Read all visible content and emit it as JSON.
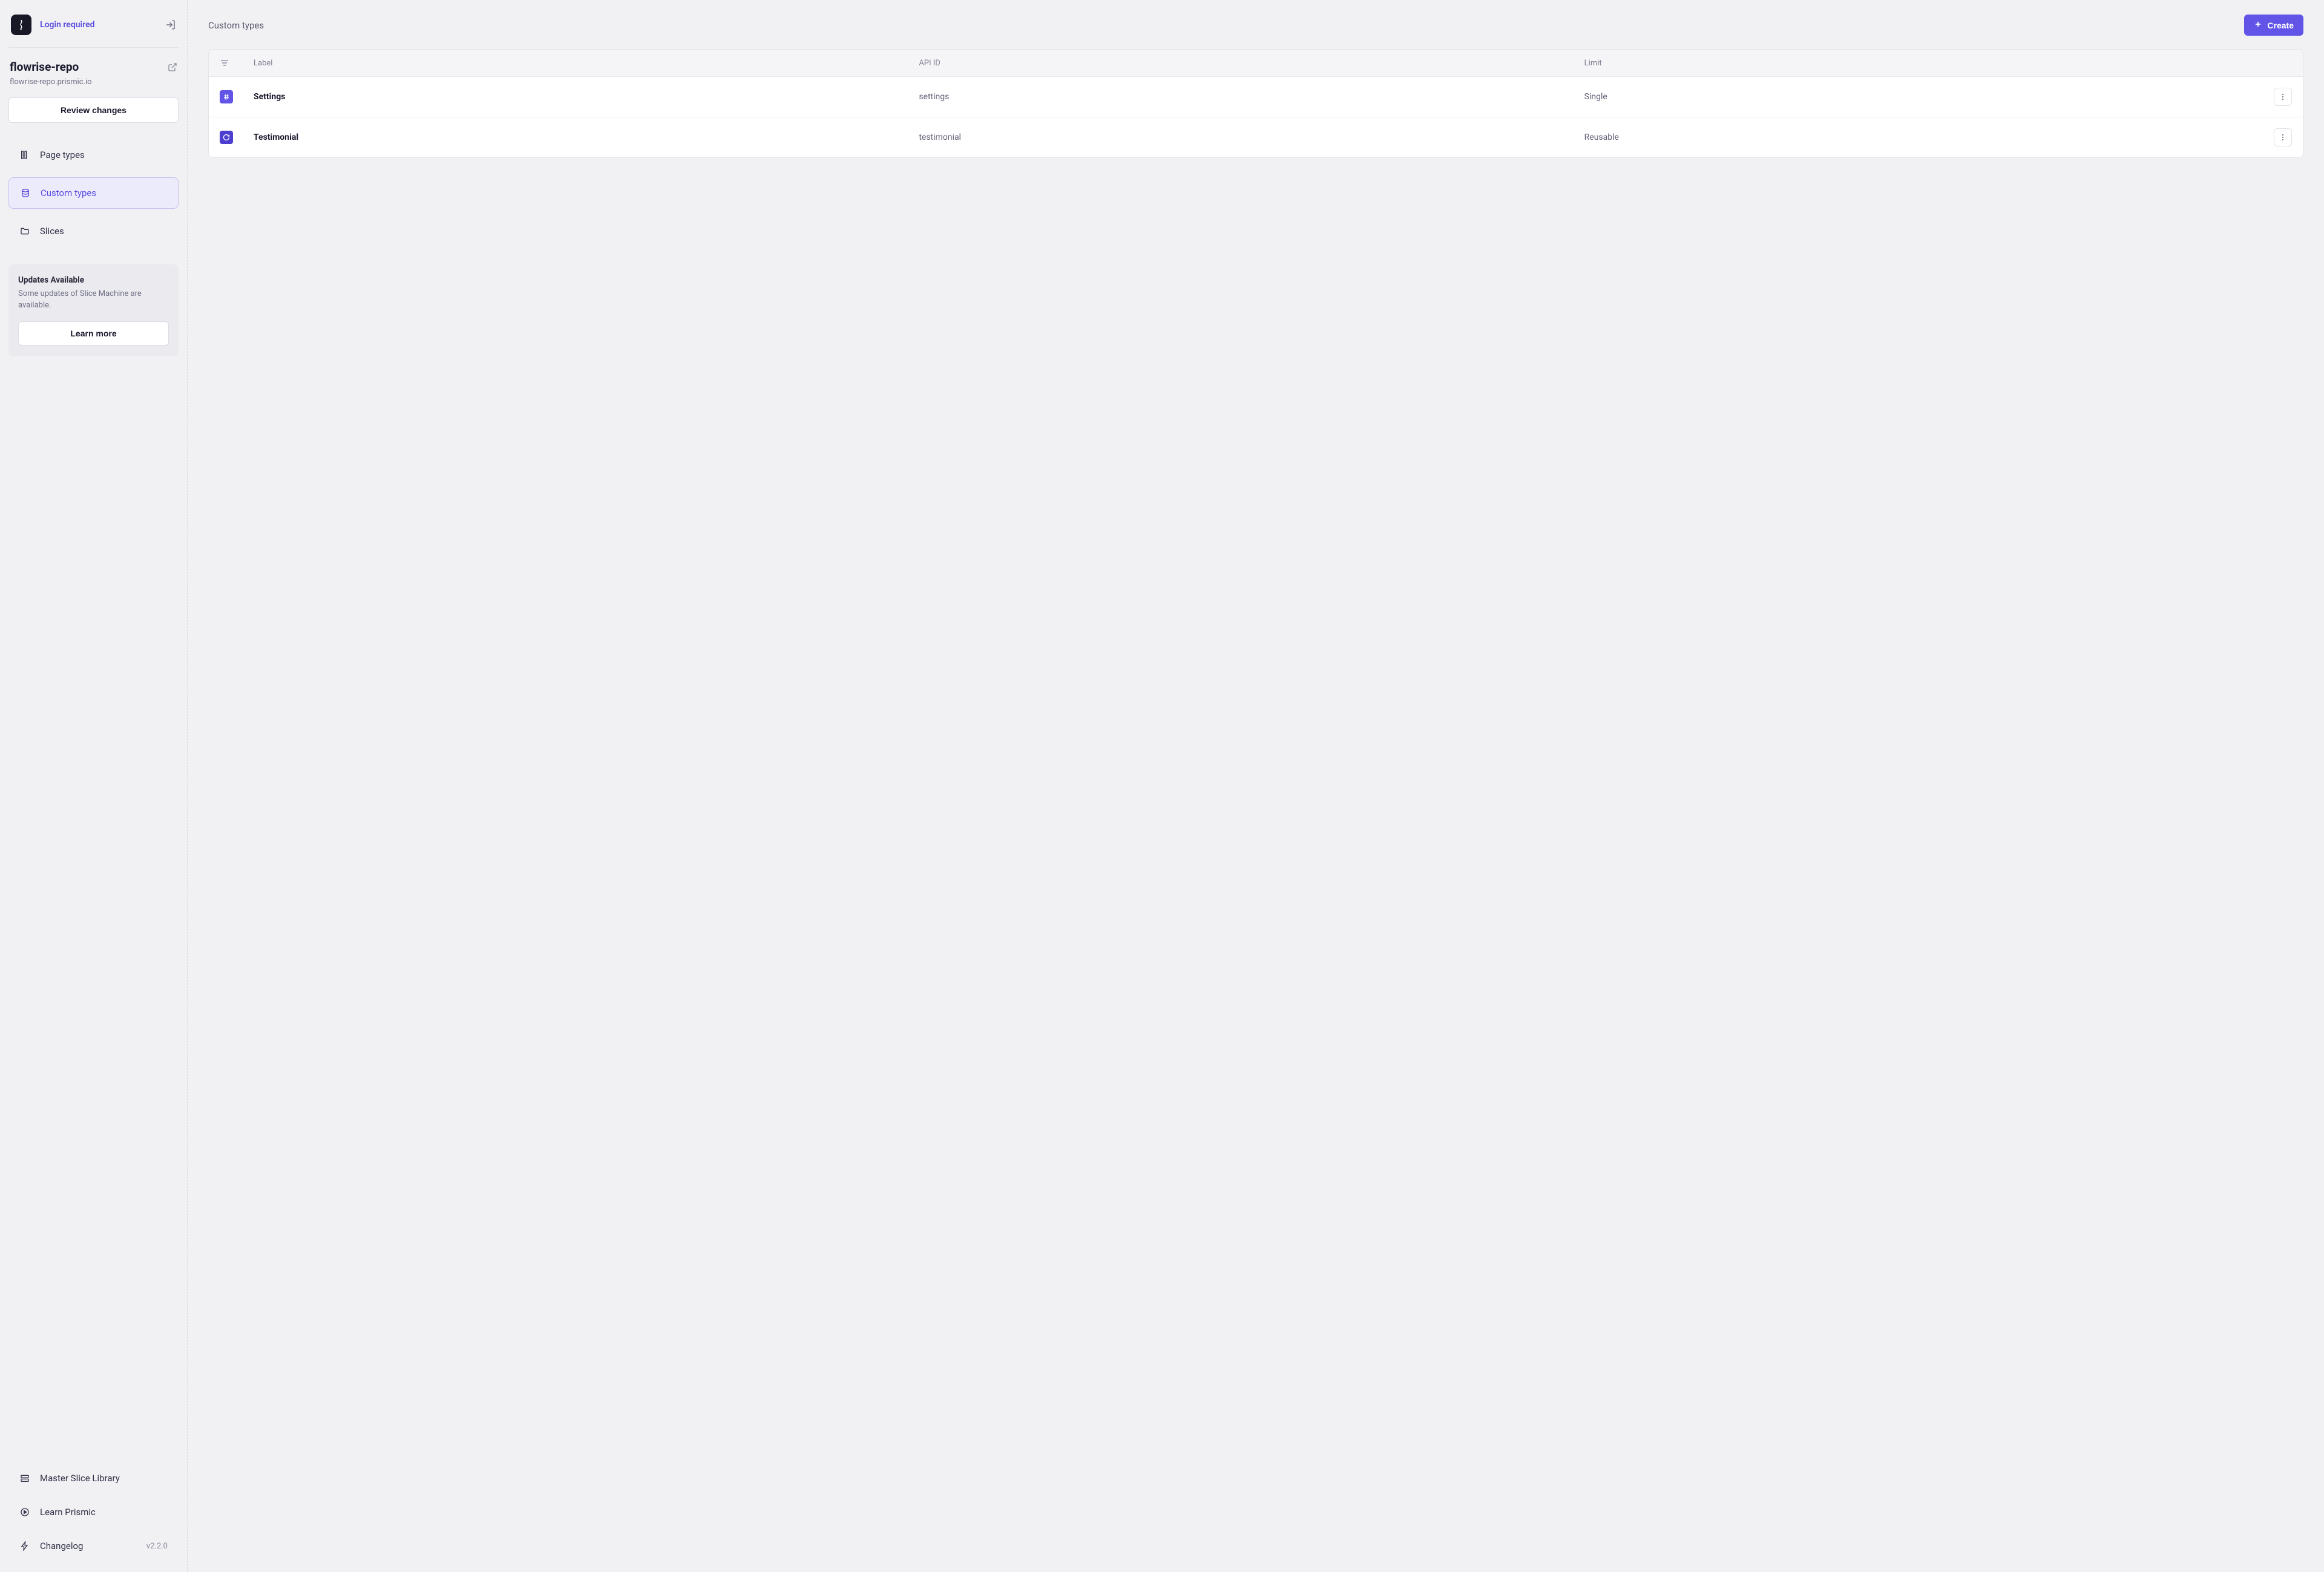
{
  "header": {
    "login_text": "Login required"
  },
  "repo": {
    "name": "flowrise-repo",
    "url": "flowrise-repo.prismic.io",
    "review_button": "Review changes"
  },
  "nav": {
    "items": [
      {
        "label": "Page types",
        "icon": "layout-icon",
        "active": false
      },
      {
        "label": "Custom types",
        "icon": "database-icon",
        "active": true
      },
      {
        "label": "Slices",
        "icon": "folder-icon",
        "active": false
      }
    ]
  },
  "updates": {
    "title": "Updates Available",
    "description": "Some updates of Slice Machine are available.",
    "button": "Learn more"
  },
  "bottom_nav": {
    "items": [
      {
        "label": "Master Slice Library",
        "icon": "stack-icon"
      },
      {
        "label": "Learn Prismic",
        "icon": "play-circle-icon"
      },
      {
        "label": "Changelog",
        "icon": "lightning-icon"
      }
    ],
    "version": "v2.2.0"
  },
  "page": {
    "title": "Custom types",
    "create_button": "Create"
  },
  "table": {
    "columns": {
      "label": "Label",
      "api": "API ID",
      "limit": "Limit"
    },
    "rows": [
      {
        "label": "Settings",
        "api": "settings",
        "limit": "Single",
        "icon": "hash"
      },
      {
        "label": "Testimonial",
        "api": "testimonial",
        "limit": "Reusable",
        "icon": "reuse"
      }
    ]
  }
}
